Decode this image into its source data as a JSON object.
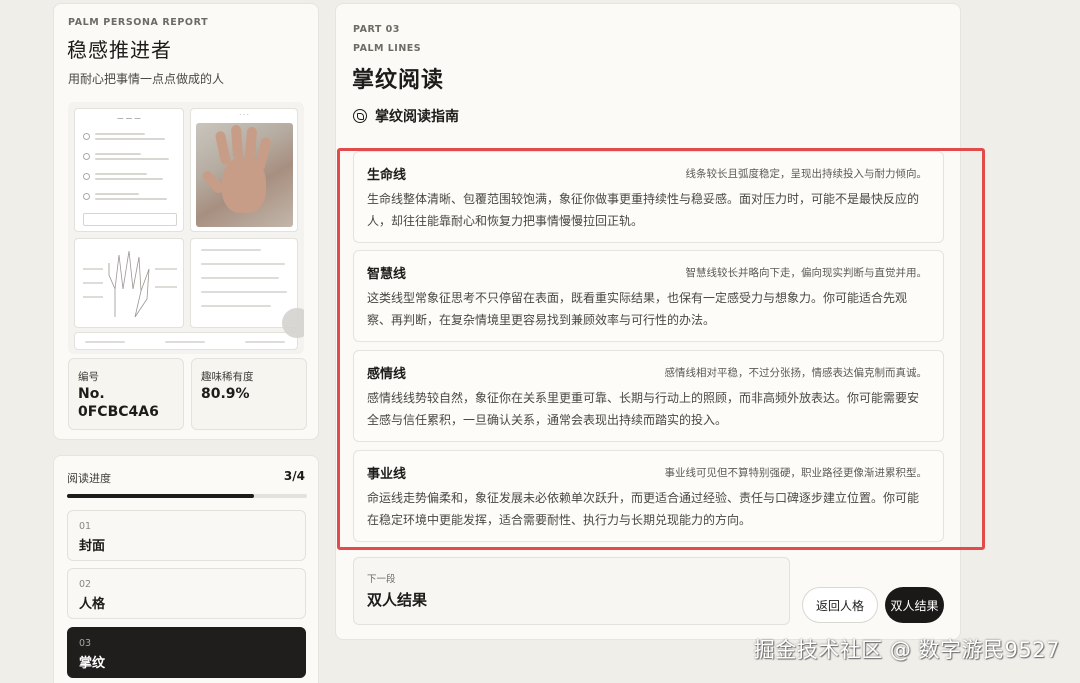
{
  "persona": {
    "eyebrow": "PALM PERSONA REPORT",
    "title": "稳感推进者",
    "subtitle": "用耐心把事情一点点做成的人"
  },
  "stats": {
    "id_label": "编号",
    "id_value": "No. 0FCBC4A6",
    "rarity_label": "趣味稀有度",
    "rarity_value": "80.9%"
  },
  "progress": {
    "label": "阅读进度",
    "count": "3/4",
    "fraction": 0.78,
    "steps": [
      {
        "num": "01",
        "name": "封面"
      },
      {
        "num": "02",
        "name": "人格"
      },
      {
        "num": "03",
        "name": "掌纹"
      }
    ]
  },
  "main": {
    "part": "PART 03",
    "eyebrow": "PALM LINES",
    "title": "掌纹阅读",
    "guide_heading": "掌纹阅读指南",
    "lines": [
      {
        "name": "生命线",
        "note": "线条较长且弧度稳定，呈现出持续投入与耐力倾向。",
        "desc": "生命线整体清晰、包覆范围较饱满，象征你做事更重持续性与稳妥感。面对压力时，可能不是最快反应的人，却往往能靠耐心和恢复力把事情慢慢拉回正轨。"
      },
      {
        "name": "智慧线",
        "note": "智慧线较长并略向下走，偏向现实判断与直觉并用。",
        "desc": "这类线型常象征思考不只停留在表面，既看重实际结果，也保有一定感受力与想象力。你可能适合先观察、再判断，在复杂情境里更容易找到兼顾效率与可行性的办法。"
      },
      {
        "name": "感情线",
        "note": "感情线相对平稳，不过分张扬，情感表达偏克制而真诚。",
        "desc": "感情线线势较自然，象征你在关系里更重可靠、长期与行动上的照顾，而非高频外放表达。你可能需要安全感与信任累积，一旦确认关系，通常会表现出持续而踏实的投入。"
      },
      {
        "name": "事业线",
        "note": "事业线可见但不算特别强硬，职业路径更像渐进累积型。",
        "desc": "命运线走势偏柔和，象征发展未必依赖单次跃升，而更适合通过经验、责任与口碑逐步建立位置。你可能在稳定环境中更能发挥，适合需要耐性、执行力与长期兑现能力的方向。"
      }
    ],
    "next_label": "下一段",
    "next_title": "双人结果",
    "back_button": "返回人格",
    "next_button": "双人结果"
  },
  "watermark": "掘金技术社区 @ 数字游民9527",
  "colors": {
    "accent_dark": "#1d1c1a",
    "highlight_red": "#e24b4b",
    "card_bg": "#fbfaf6",
    "page_bg": "#efeee9"
  }
}
